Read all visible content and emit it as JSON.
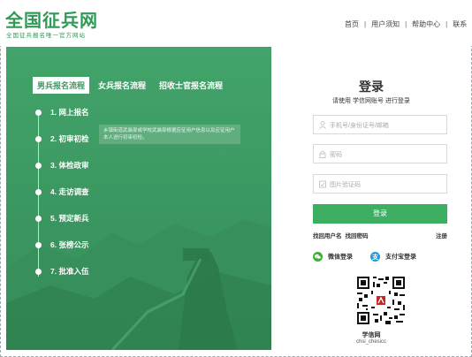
{
  "header": {
    "logo_title": "全国征兵网",
    "logo_subtitle": "全国征兵报名唯一官方网站",
    "nav": [
      "首页",
      "用户须知",
      "帮助中心",
      "联系"
    ]
  },
  "left_panel": {
    "tabs": [
      "男兵报名流程",
      "女兵报名流程",
      "招收士官报名流程"
    ],
    "active_tab": 0,
    "steps": [
      "1. 网上报名",
      "2. 初审初检",
      "3. 体检政审",
      "4. 走访调查",
      "5. 预定新兵",
      "6. 张榜公示",
      "7. 批准入伍"
    ],
    "tooltip": "乡镇街道武装部或学校武装部根据应征用户信息以及应征用户本人进行初审初检。"
  },
  "login": {
    "title": "登录",
    "subtitle": "请使用 学信网账号 进行登录",
    "username_placeholder": "手机号/身份证号/邮箱",
    "password_placeholder": "密码",
    "captcha_placeholder": "图片验证码",
    "button_label": "登录",
    "find_username": "找回用户名",
    "find_password": "找回密码",
    "register": "注册",
    "wechat_login": "微信登录",
    "alipay_login": "支付宝登录",
    "qr_label": "学信网",
    "qr_sub": "chsi_chesicc"
  },
  "colors": {
    "brand_green": "#2f9a55",
    "panel_green": "#3c9a63",
    "button_green": "#3daf62",
    "wechat_green": "#3cb034",
    "alipay_blue": "#1a9ae0"
  }
}
